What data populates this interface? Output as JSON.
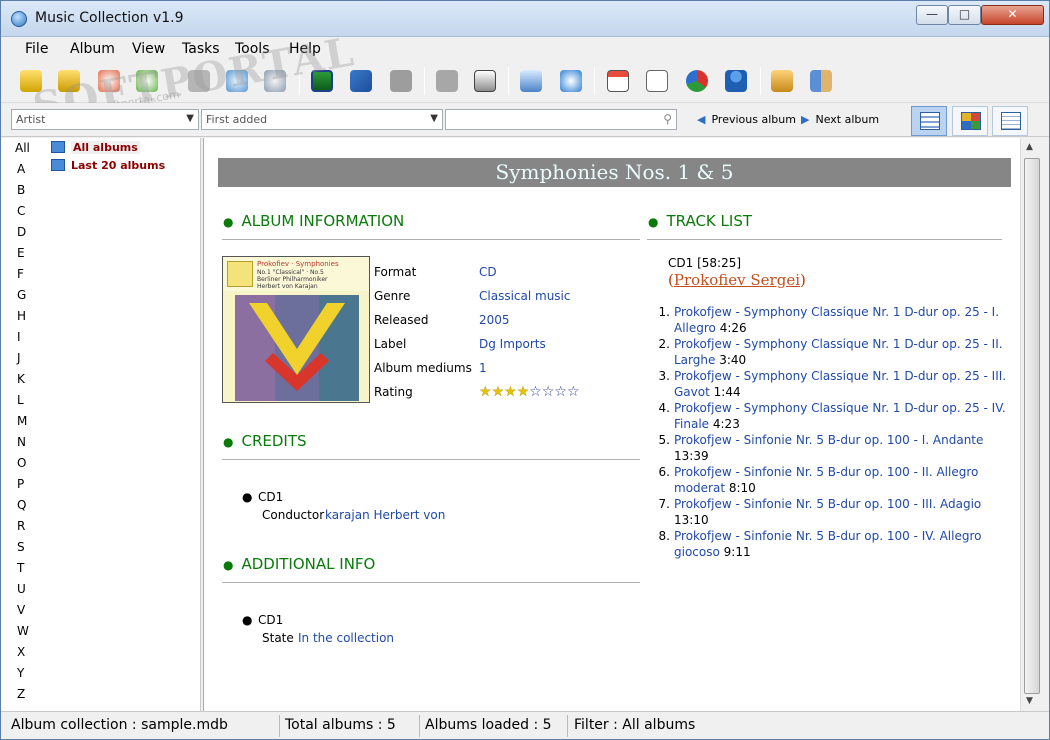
{
  "window": {
    "title": "Music Collection v1.9",
    "minimize": "—",
    "maximize": "□",
    "close": "✕"
  },
  "menu": [
    "File",
    "Album",
    "View",
    "Tasks",
    "Tools",
    "Help"
  ],
  "watermark": {
    "brand": "SOFTPORTAL",
    "url": "www.softportal.com"
  },
  "filter": {
    "group_by": "Artist",
    "sort_by": "First added",
    "search_value": "",
    "prev_label": "Previous album",
    "next_label": "Next album"
  },
  "letters": [
    "All",
    "A",
    "B",
    "C",
    "D",
    "E",
    "F",
    "G",
    "H",
    "I",
    "J",
    "K",
    "L",
    "M",
    "N",
    "O",
    "P",
    "Q",
    "R",
    "S",
    "T",
    "U",
    "V",
    "W",
    "X",
    "Y",
    "Z"
  ],
  "tree": [
    {
      "label": "All albums"
    },
    {
      "label": "Last 20 albums"
    }
  ],
  "album": {
    "title": "Symphonies Nos. 1 & 5",
    "cover": {
      "line1": "Prokofiev · Symphonies",
      "line2": "No.1 \"Classical\" · No.5",
      "line3": "Berliner Philharmoniker",
      "line4": "Herbert von Karajan"
    },
    "sections": {
      "info": "ALBUM INFORMATION",
      "tracks": "TRACK LIST",
      "credits": "CREDITS",
      "additional": "ADDITIONAL INFO"
    },
    "info": [
      {
        "label": "Format",
        "value": "CD"
      },
      {
        "label": "Genre",
        "value": "Classical music"
      },
      {
        "label": "Released",
        "value": "2005"
      },
      {
        "label": "Label",
        "value": "Dg Imports"
      },
      {
        "label": "Album mediums",
        "value": "1"
      },
      {
        "label": "Rating",
        "value": ""
      }
    ],
    "rating": {
      "value": 4,
      "max": 8
    },
    "credits": {
      "disc": "CD1",
      "role": "Conductor",
      "person": "karajan Herbert von"
    },
    "additional": {
      "disc": "CD1",
      "key": "State",
      "value": "In the collection"
    },
    "tracklist": {
      "disc": "CD1 [58:25]",
      "artist_open": "(",
      "artist": "Prokofiev Sergei",
      "artist_close": ")",
      "tracks": [
        {
          "num": "1.",
          "title": "Prokofjew - Symphony Classique Nr. 1 D-dur op. 25 - I. Allegro",
          "duration": "4:26"
        },
        {
          "num": "2.",
          "title": "Prokofjew - Symphony Classique Nr. 1 D-dur op. 25 - II. Larghe",
          "duration": "3:40"
        },
        {
          "num": "3.",
          "title": "Prokofjew - Symphony Classique Nr. 1 D-dur op. 25 - III. Gavot",
          "duration": "1:44"
        },
        {
          "num": "4.",
          "title": "Prokofjew - Symphony Classique Nr. 1 D-dur op. 25 - IV. Finale",
          "duration": "4:23"
        },
        {
          "num": "5.",
          "title": "Prokofjew - Sinfonie Nr. 5 B-dur op. 100 - I. Andante",
          "duration": "13:39"
        },
        {
          "num": "6.",
          "title": "Prokofjew - Sinfonie Nr. 5 B-dur op. 100 - II. Allegro moderat",
          "duration": "8:10"
        },
        {
          "num": "7.",
          "title": "Prokofjew - Sinfonie Nr. 5 B-dur op. 100 - III. Adagio",
          "duration": "13:10"
        },
        {
          "num": "8.",
          "title": "Prokofjew - Sinfonie Nr. 5 B-dur op. 100 - IV. Allegro giocoso",
          "duration": "9:11"
        }
      ]
    }
  },
  "status": {
    "collection": "Album collection : sample.mdb",
    "total": "Total albums : 5",
    "loaded": "Albums loaded : 5",
    "filter": "Filter : All albums"
  },
  "colors": {
    "section": "#0a7b0a",
    "link": "#1f4aa6",
    "banner_bg": "#868686",
    "banner_text": "#eafcfc",
    "artist": "#c0501f"
  }
}
